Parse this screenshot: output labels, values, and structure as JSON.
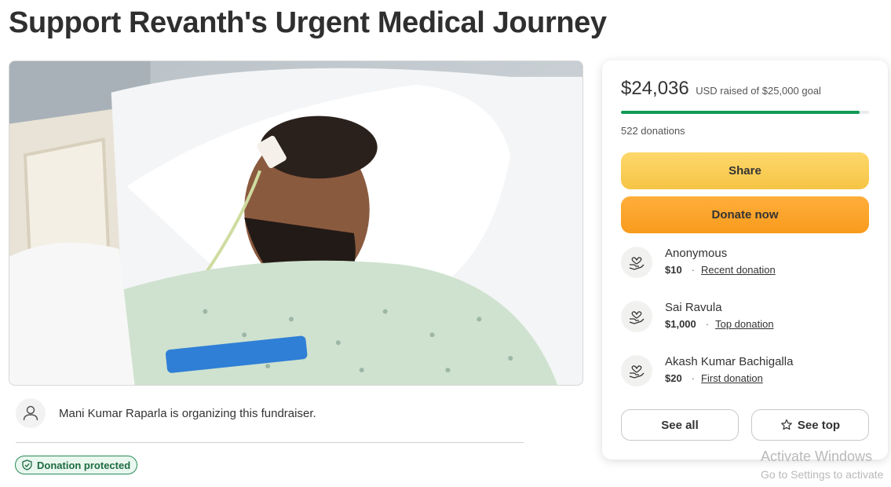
{
  "page": {
    "title": "Support Revanth's Urgent Medical Journey"
  },
  "hero": {
    "alt": "Patient in hospital bed with nasal feeding tube"
  },
  "organizer": {
    "text": "Mani Kumar Raparla is organizing this fundraiser."
  },
  "badge": {
    "label": "Donation protected"
  },
  "stats": {
    "raised": "$24,036",
    "goal_text": "USD raised of $25,000 goal",
    "progress_fraction": 0.961,
    "donations_count": "522 donations"
  },
  "buttons": {
    "share": "Share",
    "donate": "Donate now",
    "see_all": "See all",
    "see_top": "See top"
  },
  "donors": [
    {
      "name": "Anonymous",
      "amount": "$10",
      "tag": "Recent donation"
    },
    {
      "name": "Sai Ravula",
      "amount": "$1,000",
      "tag": "Top donation"
    },
    {
      "name": "Akash Kumar Bachigalla",
      "amount": "$20",
      "tag": "First donation"
    }
  ],
  "watermark": {
    "line1": "Activate Windows",
    "line2": "Go to Settings to activate"
  },
  "colors": {
    "progress": "#109a55",
    "share_button": "#f6c445",
    "donate_button": "#f89b1c",
    "badge_green": "#2a8a57"
  }
}
